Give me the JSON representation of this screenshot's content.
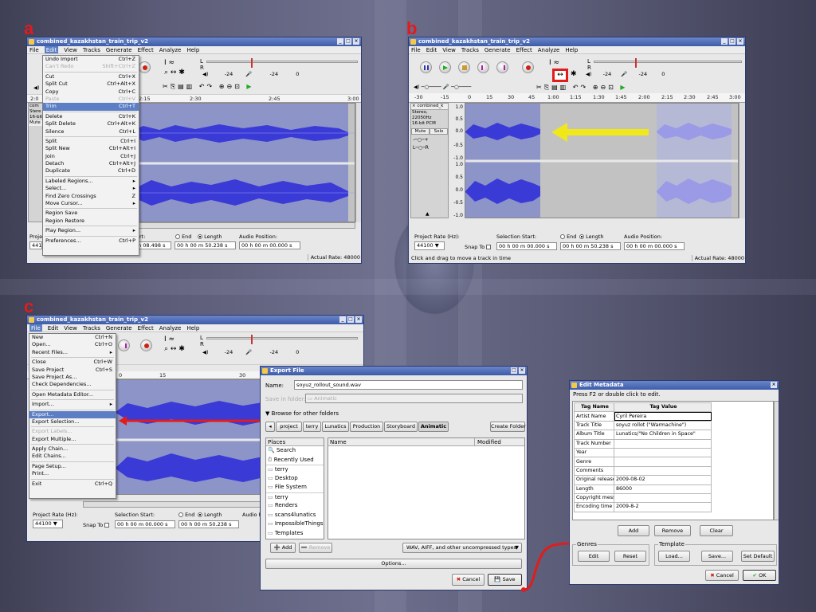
{
  "labels": {
    "a": "a",
    "b": "b",
    "c": "c"
  },
  "window_title": "combined_kazakhstan_train_trip_v2",
  "menubar": [
    "File",
    "Edit",
    "View",
    "Tracks",
    "Generate",
    "Effect",
    "Analyze",
    "Help"
  ],
  "edit_menu": [
    {
      "label": "Undo Import",
      "acc": "Ctrl+Z"
    },
    {
      "label": "Can't Redo",
      "acc": "Shift+Ctrl+Z",
      "disabled": true
    },
    {
      "sep": true
    },
    {
      "label": "Cut",
      "acc": "Ctrl+X"
    },
    {
      "label": "Split Cut",
      "acc": "Ctrl+Alt+X"
    },
    {
      "label": "Copy",
      "acc": "Ctrl+C"
    },
    {
      "label": "Paste",
      "acc": "Ctrl+V",
      "disabled": true
    },
    {
      "label": "Trim",
      "acc": "Ctrl+T",
      "selected": true
    },
    {
      "sep": true
    },
    {
      "label": "Delete",
      "acc": "Ctrl+K"
    },
    {
      "label": "Split Delete",
      "acc": "Ctrl+Alt+K"
    },
    {
      "label": "Silence",
      "acc": "Ctrl+L"
    },
    {
      "sep": true
    },
    {
      "label": "Split",
      "acc": "Ctrl+I"
    },
    {
      "label": "Split New",
      "acc": "Ctrl+Alt+I"
    },
    {
      "label": "Join",
      "acc": "Ctrl+J"
    },
    {
      "label": "Detach",
      "acc": "Ctrl+Alt+J"
    },
    {
      "label": "Duplicate",
      "acc": "Ctrl+D"
    },
    {
      "sep": true
    },
    {
      "label": "Labeled Regions...",
      "acc": "▸"
    },
    {
      "label": "Select...",
      "acc": "▸"
    },
    {
      "label": "Find Zero Crossings",
      "acc": "Z"
    },
    {
      "label": "Move Cursor...",
      "acc": "▸"
    },
    {
      "sep": true
    },
    {
      "label": "Region Save",
      "acc": ""
    },
    {
      "label": "Region Restore",
      "acc": ""
    },
    {
      "sep": true
    },
    {
      "label": "Play Region...",
      "acc": "▸"
    },
    {
      "sep": true
    },
    {
      "label": "Preferences...",
      "acc": "Ctrl+P"
    }
  ],
  "file_menu": [
    {
      "label": "New",
      "acc": "Ctrl+N"
    },
    {
      "label": "Open...",
      "acc": "Ctrl+O"
    },
    {
      "label": "Recent Files...",
      "acc": "▸"
    },
    {
      "sep": true
    },
    {
      "label": "Close",
      "acc": "Ctrl+W"
    },
    {
      "label": "Save Project",
      "acc": "Ctrl+S"
    },
    {
      "label": "Save Project As...",
      "acc": ""
    },
    {
      "label": "Check Dependencies...",
      "acc": ""
    },
    {
      "sep": true
    },
    {
      "label": "Open Metadata Editor...",
      "acc": ""
    },
    {
      "sep": true
    },
    {
      "label": "Import...",
      "acc": "▸"
    },
    {
      "sep": true
    },
    {
      "label": "Export...",
      "acc": "",
      "selected": true
    },
    {
      "label": "Export Selection...",
      "acc": ""
    },
    {
      "sep": true
    },
    {
      "label": "Export Labels...",
      "acc": "",
      "disabled": true
    },
    {
      "label": "Export Multiple...",
      "acc": ""
    },
    {
      "sep": true
    },
    {
      "label": "Apply Chain...",
      "acc": ""
    },
    {
      "label": "Edit Chains...",
      "acc": ""
    },
    {
      "sep": true
    },
    {
      "label": "Page Setup...",
      "acc": ""
    },
    {
      "label": "Print...",
      "acc": ""
    },
    {
      "sep": true
    },
    {
      "label": "Exit",
      "acc": "Ctrl+Q"
    }
  ],
  "meter": {
    "l": "L",
    "r": "R",
    "db": "-24",
    "zero": "0"
  },
  "ruler_a": [
    "2:0",
    "2:15",
    "2:30",
    "2:45",
    "3:00"
  ],
  "ruler_b": [
    "-30",
    "-15",
    "0",
    "15",
    "30",
    "45",
    "1:00",
    "1:15",
    "1:30",
    "1:45",
    "2:00",
    "2:15",
    "2:30",
    "2:45",
    "3:00"
  ],
  "ruler_c": [
    "0",
    "15",
    "30"
  ],
  "track": {
    "name": "combined_k",
    "info1": "Stereo, 22050Hz",
    "info2": "16-bit PCM",
    "mute": "Mute",
    "solo": "Solo",
    "scale": [
      "1.0",
      "0.5",
      "0.0",
      "-0.5",
      "-1.0",
      "1.0",
      "0.5",
      "0.0",
      "-0.5",
      "-1.0"
    ]
  },
  "track_a": {
    "name": "com",
    "info1": "Stere",
    "info2": "16-bit",
    "mute": "Mute"
  },
  "status": {
    "rate_label": "Project Rate (Hz):",
    "rate": "44100",
    "snap": "Snap To",
    "sel_start": "Selection Start:",
    "end": "End",
    "length": "Length",
    "audio_pos": "Audio Position:",
    "t0": "00 h 00 m 00.000 s",
    "t_len": "00 h 00 m 50.238 s",
    "t_start_a": "00 h 00 m 08.498 s",
    "t_len_a": "00 h 00 m 50.238 s",
    "t_pos_a": "00 h 00 m 00.000 s",
    "actual": "Actual Rate: 48000",
    "hint": "Click and drag to move a track in time",
    "rate_a": "Proje",
    "rate_a2": "441",
    "sel_a": "art:"
  },
  "export": {
    "title": "Export File",
    "name_label": "Name:",
    "name_value": "soyuz_rollout_sound.wav",
    "folder_label": "Save in folder:",
    "folder_value": "Animatic",
    "browse": "Browse for other folders",
    "crumbs": [
      "project",
      "terry",
      "Lunatics",
      "Production",
      "Storyboard",
      "Animatic"
    ],
    "create_folder": "Create Folder",
    "places_header": "Places",
    "places": [
      "Search",
      "Recently Used",
      "terry",
      "Desktop",
      "File System",
      "terry",
      "Renders",
      "scans4lunatics",
      "ImpossibleThings",
      "Templates"
    ],
    "col_name": "Name",
    "col_modified": "Modified",
    "add": "Add",
    "remove": "Remove",
    "filetype": "WAV, AIFF, and other uncompressed types",
    "options": "Options...",
    "cancel": "Cancel",
    "save": "Save"
  },
  "metadata": {
    "title": "Edit Metadata",
    "hint": "Press F2 or double click to edit.",
    "col_tag": "Tag Name",
    "col_value": "Tag Value",
    "rows": [
      [
        "Artist Name",
        "Cyril Pereira"
      ],
      [
        "Track Title",
        "soyuz rollot (\"Warmachine\")"
      ],
      [
        "Album Title",
        "Lunatics/\"No Children in Space\""
      ],
      [
        "Track Number",
        ""
      ],
      [
        "Year",
        ""
      ],
      [
        "Genre",
        ""
      ],
      [
        "Comments",
        ""
      ],
      [
        "Original release",
        "2009-08-02"
      ],
      [
        "Length",
        "86000"
      ],
      [
        "Copyright message",
        ""
      ],
      [
        "Encoding time",
        "2009-8-2"
      ]
    ],
    "add": "Add",
    "remove": "Remove",
    "clear": "Clear",
    "genres": "Genres",
    "edit": "Edit",
    "reset": "Reset",
    "template": "Template",
    "load": "Load...",
    "save": "Save...",
    "set_default": "Set Default",
    "cancel": "Cancel",
    "ok": "OK"
  },
  "colors": {
    "accent_red": "#e21b1b",
    "arrow_yellow": "#f0e81a",
    "wave_blue": "#3333cc",
    "title_blue": "#3d5ca8"
  }
}
